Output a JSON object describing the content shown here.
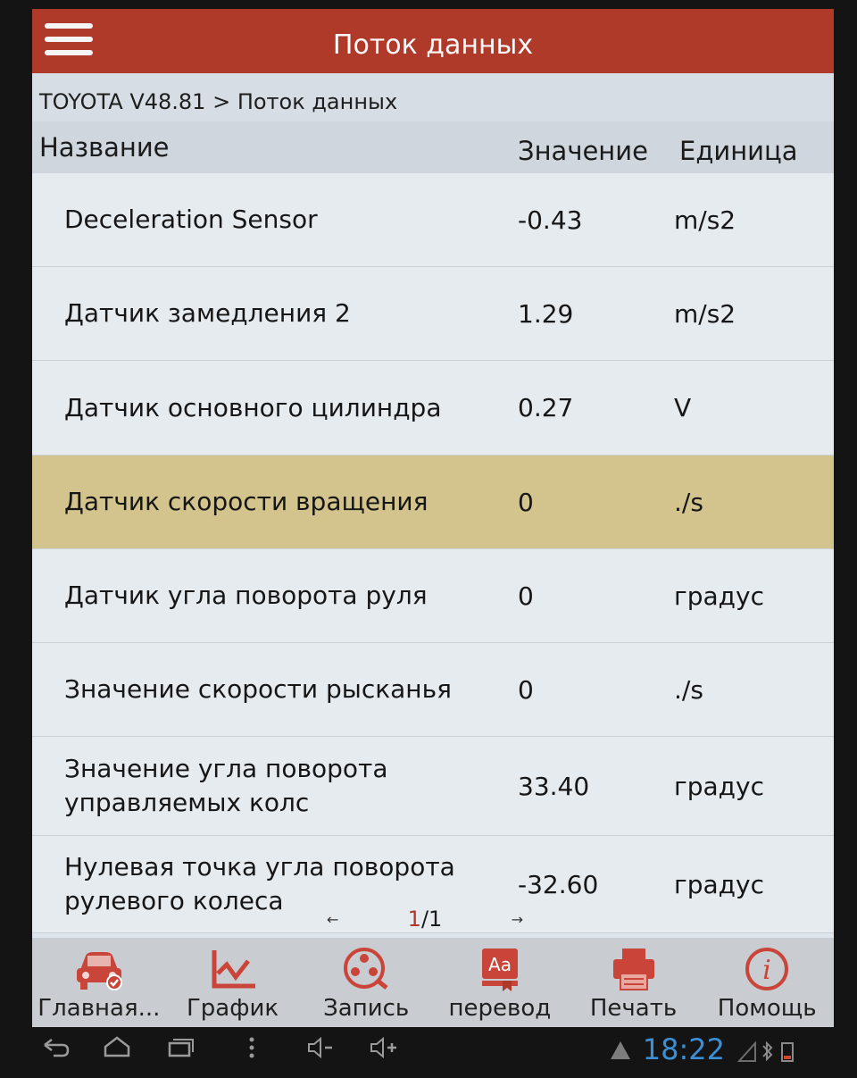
{
  "app": {
    "title": "Поток данных",
    "breadcrumb": "TOYOTA V48.81 > Поток данных"
  },
  "table": {
    "headers": {
      "name": "Название",
      "value": "Значение",
      "unit": "Единица"
    },
    "rows": [
      {
        "name": "Deceleration Sensor",
        "value": "-0.43",
        "unit": "m/s2"
      },
      {
        "name": "Датчик замедления 2",
        "value": "1.29",
        "unit": "m/s2"
      },
      {
        "name": "Датчик основного цилиндра",
        "value": "0.27",
        "unit": "V"
      },
      {
        "name": "Датчик скорости вращения",
        "value": "0",
        "unit": "./s",
        "selected": true
      },
      {
        "name": "Датчик угла поворота руля",
        "value": "0",
        "unit": "градус"
      },
      {
        "name": "Значение скорости рысканья",
        "value": "0",
        "unit": "./s"
      },
      {
        "name": "Значение угла поворота управляемых колс",
        "value": "33.40",
        "unit": "градус"
      },
      {
        "name": "Нулевая точка угла поворота рулевого колеса",
        "value": "-32.60",
        "unit": "градус"
      }
    ],
    "selected_color": "#d3c48d"
  },
  "pager": {
    "current": "1",
    "separator": "/",
    "total": "1",
    "prev": "←",
    "next": "→"
  },
  "toolbar": {
    "items": [
      {
        "label": "Главная...",
        "icon": "car-icon"
      },
      {
        "label": "График",
        "icon": "chart-icon"
      },
      {
        "label": "Запись",
        "icon": "film-reel-icon"
      },
      {
        "label": "перевод",
        "icon": "translate-icon"
      },
      {
        "label": "Печать",
        "icon": "printer-icon"
      },
      {
        "label": "Помощь",
        "icon": "info-icon"
      }
    ]
  },
  "system": {
    "clock": "18:22",
    "accent": "#b03a2a",
    "clock_color": "#3b8fd4"
  }
}
